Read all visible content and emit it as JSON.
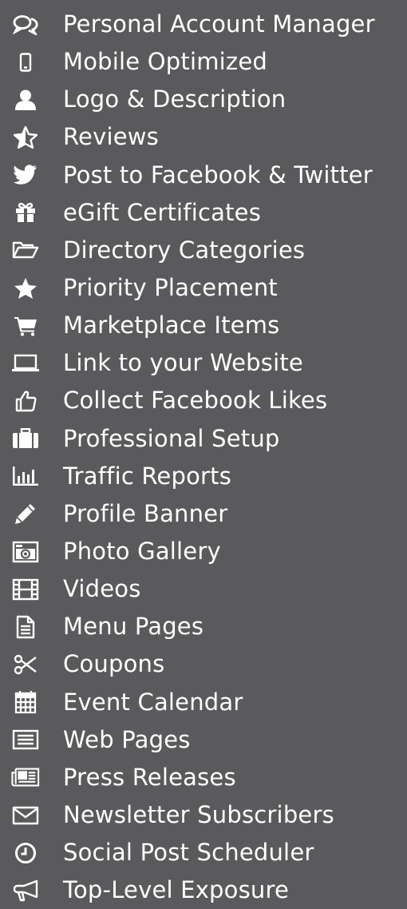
{
  "features": [
    {
      "icon": "chat-bubbles-icon",
      "label": "Personal Account Manager"
    },
    {
      "icon": "mobile-phone-icon",
      "label": "Mobile Optimized"
    },
    {
      "icon": "user-icon",
      "label": "Logo & Description"
    },
    {
      "icon": "star-half-icon",
      "label": "Reviews"
    },
    {
      "icon": "twitter-bird-icon",
      "label": "Post to Facebook & Twitter"
    },
    {
      "icon": "gift-icon",
      "label": "eGift Certificates"
    },
    {
      "icon": "folder-open-icon",
      "label": "Directory Categories"
    },
    {
      "icon": "star-icon",
      "label": "Priority Placement"
    },
    {
      "icon": "shopping-cart-icon",
      "label": "Marketplace Items"
    },
    {
      "icon": "laptop-icon",
      "label": "Link to your Website"
    },
    {
      "icon": "thumbs-up-icon",
      "label": "Collect Facebook Likes"
    },
    {
      "icon": "briefcase-icon",
      "label": "Professional Setup"
    },
    {
      "icon": "bar-chart-icon",
      "label": "Traffic Reports"
    },
    {
      "icon": "pencil-icon",
      "label": "Profile Banner"
    },
    {
      "icon": "camera-icon",
      "label": "Photo Gallery"
    },
    {
      "icon": "film-icon",
      "label": "Videos"
    },
    {
      "icon": "document-icon",
      "label": "Menu Pages"
    },
    {
      "icon": "scissors-icon",
      "label": "Coupons"
    },
    {
      "icon": "calendar-icon",
      "label": "Event Calendar"
    },
    {
      "icon": "list-window-icon",
      "label": "Web Pages"
    },
    {
      "icon": "newspaper-icon",
      "label": "Press Releases"
    },
    {
      "icon": "envelope-icon",
      "label": "Newsletter Subscribers"
    },
    {
      "icon": "clock-icon",
      "label": "Social Post Scheduler"
    },
    {
      "icon": "megaphone-icon",
      "label": "Top-Level Exposure"
    }
  ],
  "colors": {
    "background": "#5a5a5c",
    "text": "#ffffff"
  }
}
